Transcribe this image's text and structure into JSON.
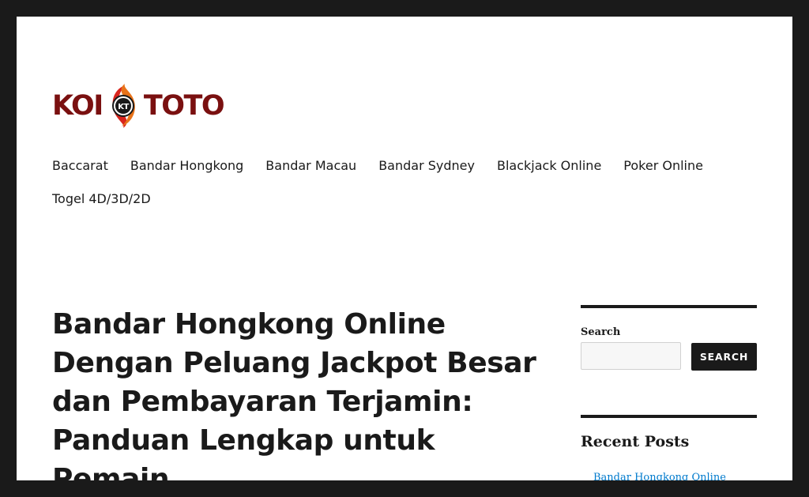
{
  "site": {
    "logo_left": "KOI",
    "logo_right": "TOTO",
    "logo_emblem_text": "KT",
    "colors": {
      "logo_red": "#7a1010",
      "koi_orange": "#e8731a",
      "link": "#007acc"
    }
  },
  "nav": {
    "items": [
      {
        "label": "Baccarat"
      },
      {
        "label": "Bandar Hongkong"
      },
      {
        "label": "Bandar Macau"
      },
      {
        "label": "Bandar Sydney"
      },
      {
        "label": "Blackjack Online"
      },
      {
        "label": "Poker Online"
      },
      {
        "label": "Togel 4D/3D/2D"
      }
    ]
  },
  "article": {
    "title": "Bandar Hongkong Online Dengan Peluang Jackpot Besar dan Pembayaran Terjamin: Panduan Lengkap untuk Pemain"
  },
  "sidebar": {
    "search": {
      "label": "Search",
      "value": "",
      "button_label": "SEARCH"
    },
    "recent_posts": {
      "title": "Recent Posts",
      "items": [
        {
          "label": "Bandar Hongkong Online"
        }
      ]
    }
  }
}
